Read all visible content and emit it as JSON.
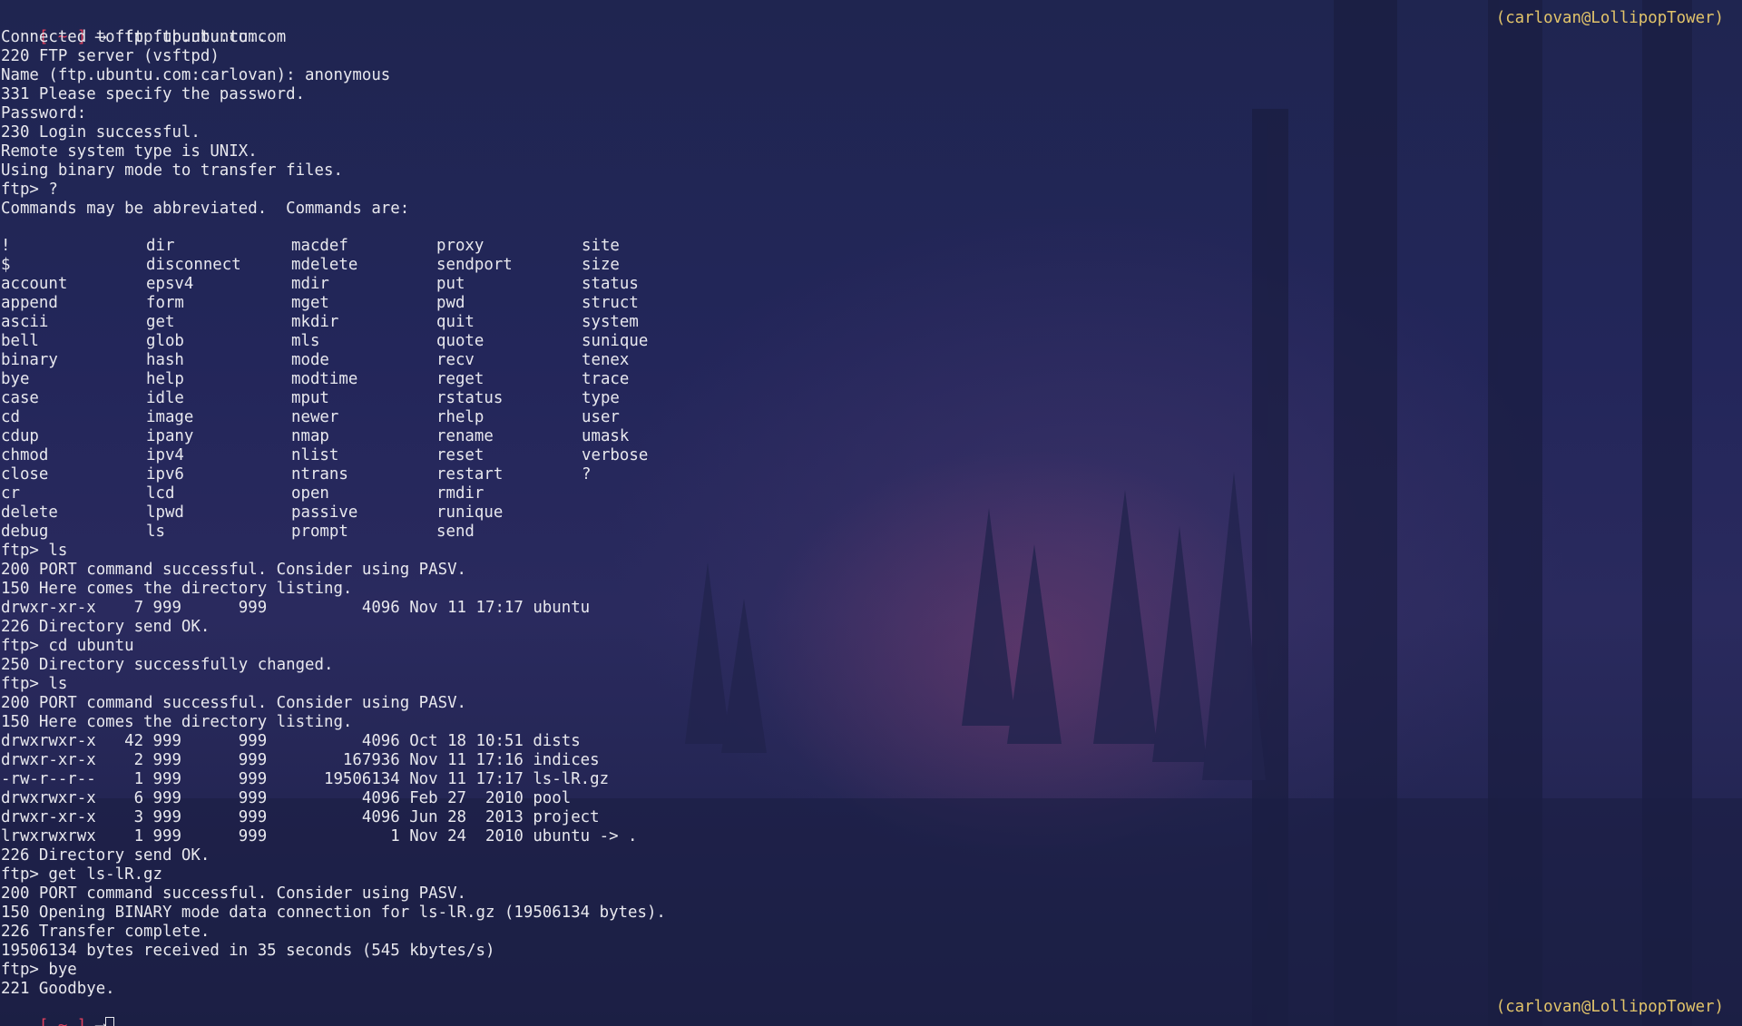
{
  "prompt": {
    "open_bracket": "[ ~ ]",
    "arrow": "⟶",
    "first_command": "ftp ftp.ubuntu.com",
    "host_label": "(carlovan@LollipopTower)"
  },
  "session_lines_1": [
    "Connected to ftp.ubuntu.com.",
    "220 FTP server (vsftpd)",
    "Name (ftp.ubuntu.com:carlovan): anonymous",
    "331 Please specify the password.",
    "Password:",
    "230 Login successful.",
    "Remote system type is UNIX.",
    "Using binary mode to transfer files.",
    "ftp> ?",
    "Commands may be abbreviated.  Commands are:"
  ],
  "commands": {
    "col1": [
      "!",
      "$",
      "account",
      "append",
      "ascii",
      "bell",
      "binary",
      "bye",
      "case",
      "cd",
      "cdup",
      "chmod",
      "close",
      "cr",
      "delete",
      "debug"
    ],
    "col2": [
      "dir",
      "disconnect",
      "epsv4",
      "form",
      "get",
      "glob",
      "hash",
      "help",
      "idle",
      "image",
      "ipany",
      "ipv4",
      "ipv6",
      "lcd",
      "lpwd",
      "ls"
    ],
    "col3": [
      "macdef",
      "mdelete",
      "mdir",
      "mget",
      "mkdir",
      "mls",
      "mode",
      "modtime",
      "mput",
      "newer",
      "nmap",
      "nlist",
      "ntrans",
      "open",
      "passive",
      "prompt"
    ],
    "col4": [
      "proxy",
      "sendport",
      "put",
      "pwd",
      "quit",
      "quote",
      "recv",
      "reget",
      "rstatus",
      "rhelp",
      "rename",
      "reset",
      "restart",
      "rmdir",
      "runique",
      "send"
    ],
    "col5": [
      "site",
      "size",
      "status",
      "struct",
      "system",
      "sunique",
      "tenex",
      "trace",
      "type",
      "user",
      "umask",
      "verbose",
      "?"
    ]
  },
  "session_lines_2": [
    "ftp> ls",
    "200 PORT command successful. Consider using PASV.",
    "150 Here comes the directory listing.",
    "drwxr-xr-x    7 999      999          4096 Nov 11 17:17 ubuntu",
    "226 Directory send OK.",
    "ftp> cd ubuntu",
    "250 Directory successfully changed.",
    "ftp> ls",
    "200 PORT command successful. Consider using PASV.",
    "150 Here comes the directory listing.",
    "drwxrwxr-x   42 999      999          4096 Oct 18 10:51 dists",
    "drwxr-xr-x    2 999      999        167936 Nov 11 17:16 indices",
    "-rw-r--r--    1 999      999      19506134 Nov 11 17:17 ls-lR.gz",
    "drwxrwxr-x    6 999      999          4096 Feb 27  2010 pool",
    "drwxr-xr-x    3 999      999          4096 Jun 28  2013 project",
    "lrwxrwxrwx    1 999      999             1 Nov 24  2010 ubuntu -> .",
    "226 Directory send OK.",
    "ftp> get ls-lR.gz",
    "200 PORT command successful. Consider using PASV.",
    "150 Opening BINARY mode data connection for ls-lR.gz (19506134 bytes).",
    "226 Transfer complete.",
    "19506134 bytes received in 35 seconds (545 kbytes/s)",
    "ftp> bye",
    "221 Goodbye."
  ],
  "colors": {
    "prompt_bracket": "#e0415c",
    "host_label": "#e2c46a",
    "text": "#e8e8ee",
    "background": "#1d2146"
  }
}
